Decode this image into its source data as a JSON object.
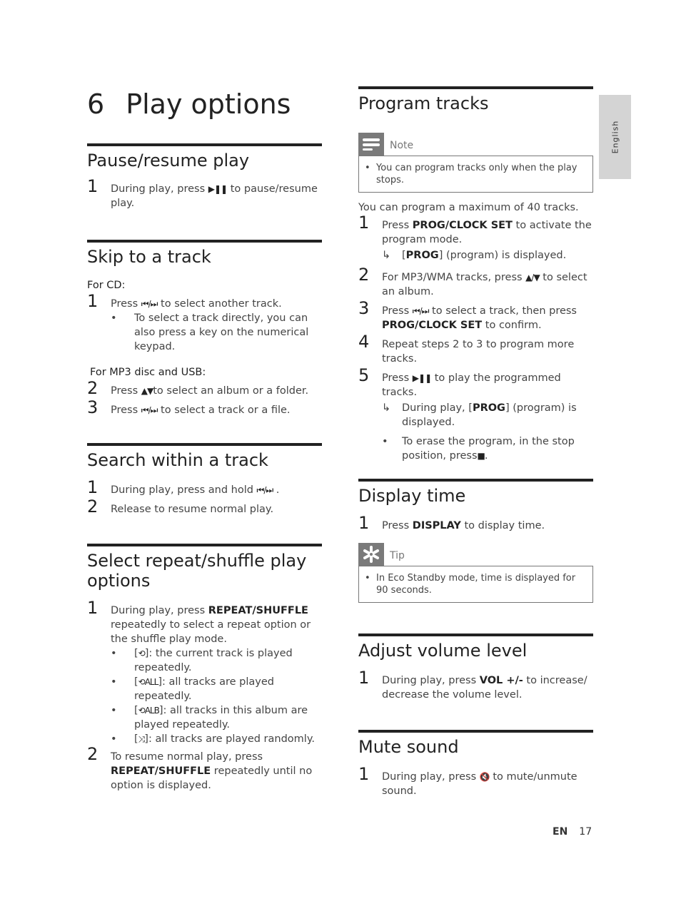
{
  "chapter": {
    "number": "6",
    "title": "Play options"
  },
  "side_tab": "English",
  "footer": {
    "lang": "EN",
    "page": "17"
  },
  "symbols": {
    "play_pause": "▶❚❚",
    "prev_next": "⏮/⏭",
    "up_down": "▲▼",
    "up_slash_down": "▲/▼",
    "stop": "■",
    "repeat": "⟲",
    "repeat_all": "⟲ALL",
    "repeat_album": "⟲ALB",
    "shuffle": "⤨",
    "mute": "🔇",
    "arrow": "↳",
    "bullet": "•"
  },
  "pause_resume": {
    "title": "Pause/resume play",
    "steps": [
      {
        "n": "1",
        "pre": "During play, press ",
        "post": " to pause/resume play."
      }
    ]
  },
  "skip": {
    "title": "Skip to a track",
    "for_cd": "For CD:",
    "cd_step": {
      "n": "1",
      "pre": "Press ",
      "post": " to select another track."
    },
    "cd_bullet": "To select a track directly, you can also press a key on the numerical keypad.",
    "for_mp3": "For MP3 disc and USB:",
    "mp3_steps": [
      {
        "n": "2",
        "pre": "Press ",
        "post": "to select an album or a folder."
      },
      {
        "n": "3",
        "pre": "Press ",
        "post": " to select a track or a file."
      }
    ]
  },
  "search": {
    "title": "Search within a track",
    "steps": [
      {
        "n": "1",
        "pre": "During play, press and hold ",
        "post": " ."
      },
      {
        "n": "2",
        "text": "Release to resume normal play."
      }
    ]
  },
  "repeat": {
    "title": "Select repeat/shuffle play options",
    "step1": {
      "n": "1",
      "pre": "During play, press ",
      "bold": "REPEAT/SHUFFLE",
      "post": " repeatedly to select a repeat option or the shuffle play mode."
    },
    "bullets": [
      {
        "text": ": the current track is played repeatedly."
      },
      {
        "text": ": all tracks are played repeatedly."
      },
      {
        "text": ": all tracks in this album are played repeatedly."
      },
      {
        "text": ": all tracks are played randomly."
      }
    ],
    "step2": {
      "n": "2",
      "pre": "To resume normal play, press ",
      "bold": "REPEAT/SHUFFLE",
      "post": " repeatedly until no option is displayed."
    }
  },
  "program": {
    "title": "Program tracks",
    "note_label": "Note",
    "note_text": "You can program tracks only when the play stops.",
    "intro": "You can program a maximum of 40 tracks.",
    "s1": {
      "n": "1",
      "pre": "Press ",
      "bold": "PROG/CLOCK SET",
      "post": " to activate the program mode."
    },
    "s1_result": {
      "bold": "PROG",
      "post": "] (program) is displayed."
    },
    "s2": {
      "n": "2",
      "pre": "For MP3/WMA tracks, press ",
      "post": " to select an album."
    },
    "s3": {
      "n": "3",
      "pre": "Press ",
      "mid": " to select a track, then press ",
      "bold": "PROG/CLOCK SET",
      "post": " to confirm."
    },
    "s4": {
      "n": "4",
      "text": "Repeat steps 2 to 3 to program more tracks."
    },
    "s5": {
      "n": "5",
      "pre": "Press ",
      "post": " to play the programmed tracks."
    },
    "s5_result": {
      "pre": "During play, [",
      "bold": "PROG",
      "post": "] (program) is displayed."
    },
    "s5_bullet": {
      "pre": "To erase the program, in the stop position, press",
      "post": "."
    }
  },
  "display_time": {
    "title": "Display time",
    "s1": {
      "n": "1",
      "pre": "Press ",
      "bold": "DISPLAY",
      "post": " to display time."
    },
    "tip_label": "Tip",
    "tip_text": "In Eco Standby mode, time is displayed for 90 seconds."
  },
  "volume": {
    "title": "Adjust volume level",
    "s1": {
      "n": "1",
      "pre": "During play, press ",
      "bold": "VOL +/-",
      "post": " to increase/ decrease the volume level."
    }
  },
  "mute": {
    "title": "Mute sound",
    "s1": {
      "n": "1",
      "pre": "During play, press ",
      "post": " to mute/unmute sound."
    }
  }
}
